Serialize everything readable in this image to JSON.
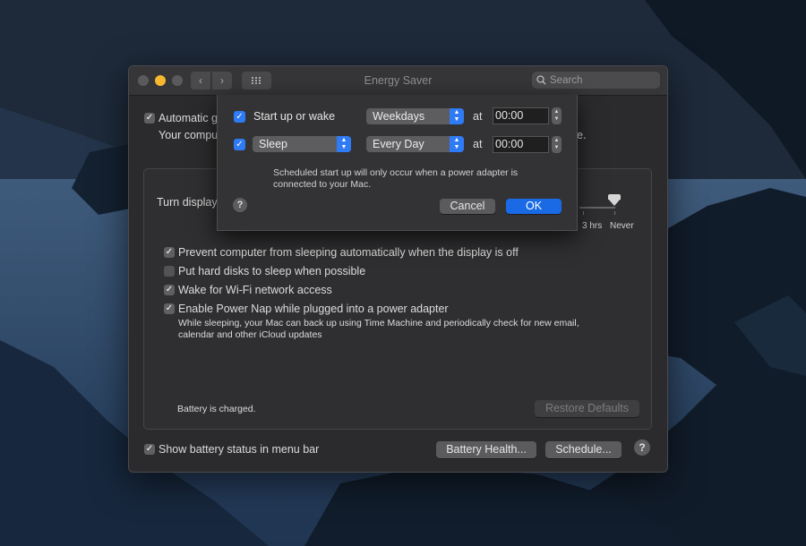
{
  "window": {
    "title": "Energy Saver",
    "search_placeholder": "Search",
    "automatic_label": "Automatic g",
    "automatic_desc_left": "Your compu",
    "automatic_desc_right": "e.",
    "turn_display_label": "Turn display",
    "slider": {
      "tick_labels": [
        "3 hrs",
        "Never"
      ]
    },
    "options": [
      {
        "label": "Prevent computer from sleeping automatically when the display is off",
        "checked": true
      },
      {
        "label": "Put hard disks to sleep when possible",
        "checked": false
      },
      {
        "label": "Wake for Wi-Fi network access",
        "checked": true
      },
      {
        "label": "Enable Power Nap while plugged into a power adapter",
        "checked": true
      }
    ],
    "power_nap_desc_1": "While sleeping, your Mac can back up using Time Machine and periodically check for new email,",
    "power_nap_desc_2": "calendar and other iCloud updates",
    "battery_status": "Battery is charged.",
    "restore_defaults": "Restore Defaults",
    "show_battery_status": "Show battery status in menu bar",
    "battery_health": "Battery Health...",
    "schedule": "Schedule...",
    "help": "?"
  },
  "sheet": {
    "row1": {
      "label": "Start up or wake",
      "day": "Weekdays",
      "at": "at",
      "time": "00:00"
    },
    "row2": {
      "action": "Sleep",
      "day": "Every Day",
      "at": "at",
      "time": "00:00"
    },
    "note_line1": "Scheduled start up will only occur when a power adapter is",
    "note_line2": "connected to your Mac.",
    "cancel": "Cancel",
    "ok": "OK",
    "help": "?"
  },
  "colors": {
    "accent": "#2f7bf5",
    "ok_button": "#1a6ae6",
    "minimize": "#f5b82e"
  },
  "icons": [
    "search-icon",
    "chevron-left-icon",
    "chevron-right-icon",
    "grid-icon",
    "checkmark-icon",
    "updown-chevron-icon",
    "help-icon"
  ]
}
